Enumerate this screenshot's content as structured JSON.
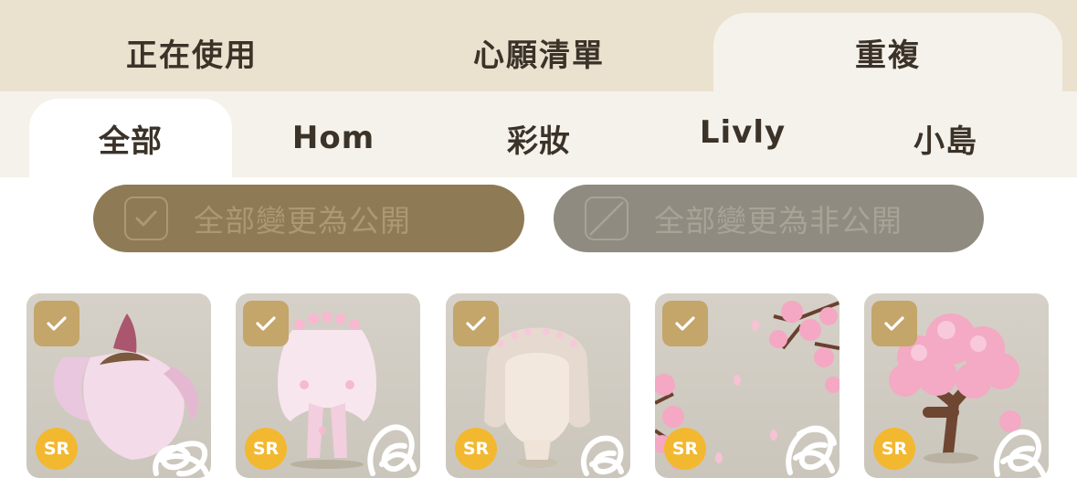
{
  "top_tabs": [
    {
      "label": "正在使用",
      "active": false
    },
    {
      "label": "心願清單",
      "active": false
    },
    {
      "label": "重複",
      "active": true
    }
  ],
  "sub_tabs": [
    {
      "label": "全部",
      "active": true
    },
    {
      "label": "Hom",
      "active": false
    },
    {
      "label": "彩妝",
      "active": false
    },
    {
      "label": "Livly",
      "active": false
    },
    {
      "label": "小島",
      "active": false
    }
  ],
  "actions": {
    "make_all_public": "全部變更為公開",
    "make_all_private": "全部變更為非公開"
  },
  "items": [
    {
      "rarity": "SR",
      "checked": true,
      "icon": "flower-petal-hat-icon"
    },
    {
      "rarity": "SR",
      "checked": true,
      "icon": "floral-veil-outfit-icon"
    },
    {
      "rarity": "SR",
      "checked": true,
      "icon": "flower-crown-hair-icon"
    },
    {
      "rarity": "SR",
      "checked": true,
      "icon": "cherry-blossom-branch-icon"
    },
    {
      "rarity": "SR",
      "checked": true,
      "icon": "cherry-blossom-tree-icon"
    }
  ],
  "colors": {
    "tab_bar": "#ebe1cf",
    "sub_tab_bar": "#f5f2ec",
    "public_button": "#8e7b55",
    "private_button": "#8f8b80",
    "check_badge": "#c4a56a",
    "rarity_badge": "#f2b830"
  }
}
